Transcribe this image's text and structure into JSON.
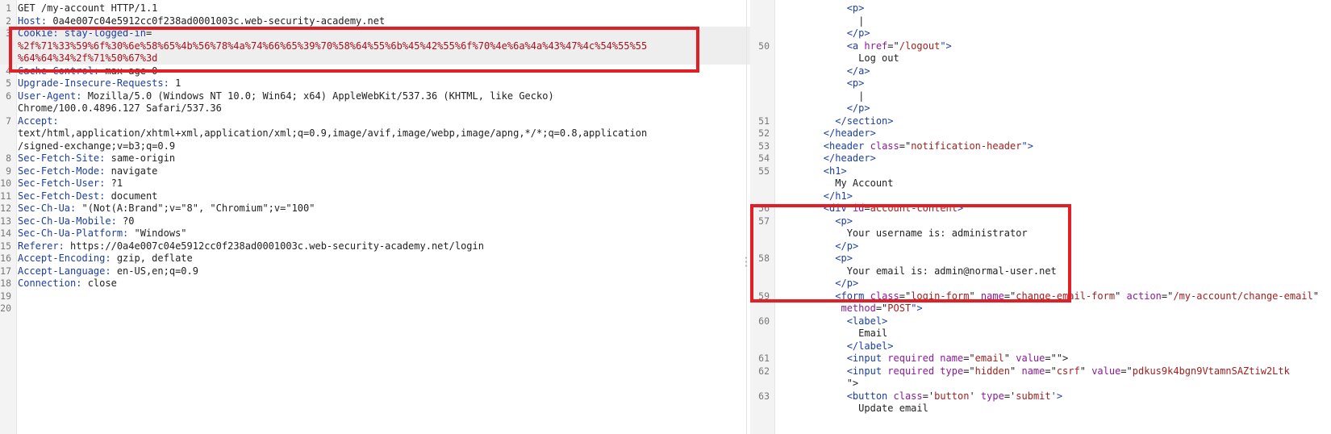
{
  "request": {
    "lines": [
      {
        "n": "1",
        "segs": [
          {
            "t": "GET /my-account HTTP/1.1",
            "c": "txt"
          }
        ]
      },
      {
        "n": "2",
        "segs": [
          {
            "t": "Host: ",
            "c": "hk"
          },
          {
            "t": "0a4e007c04e5912cc0f238ad0001003c.web-security-academy.net",
            "c": "txt"
          }
        ]
      },
      {
        "n": "3",
        "hl": true,
        "segs": [
          {
            "t": "Cookie: ",
            "c": "hk"
          },
          {
            "t": "stay-logged-in",
            "c": "hk"
          },
          {
            "t": "=",
            "c": "txt"
          }
        ]
      },
      {
        "n": "",
        "hl": true,
        "segs": [
          {
            "t": "%2f%71%33%59%6f%30%6e%58%65%4b%56%78%4a%74%66%65%39%70%58%64%55%6b%45%42%55%6f%70%4e%6a%4a%43%47%4c%54%55%55",
            "c": "cookie"
          }
        ]
      },
      {
        "n": "",
        "hl": true,
        "segs": [
          {
            "t": "%64%64%34%2f%71%50%67%3d",
            "c": "cookie"
          }
        ]
      },
      {
        "n": "4",
        "segs": [
          {
            "t": "Cache-Control: ",
            "c": "hk"
          },
          {
            "t": "max-age=0",
            "c": "txt"
          }
        ]
      },
      {
        "n": "5",
        "segs": [
          {
            "t": "Upgrade-Insecure-Requests: ",
            "c": "hk"
          },
          {
            "t": "1",
            "c": "txt"
          }
        ]
      },
      {
        "n": "6",
        "segs": [
          {
            "t": "User-Agent: ",
            "c": "hk"
          },
          {
            "t": "Mozilla/5.0 (Windows NT 10.0; Win64; x64) AppleWebKit/537.36 (KHTML, like Gecko)",
            "c": "txt"
          }
        ]
      },
      {
        "n": "",
        "segs": [
          {
            "t": "Chrome/100.0.4896.127 Safari/537.36",
            "c": "txt"
          }
        ]
      },
      {
        "n": "7",
        "segs": [
          {
            "t": "Accept: ",
            "c": "hk"
          }
        ]
      },
      {
        "n": "",
        "segs": [
          {
            "t": "text/html,application/xhtml+xml,application/xml;q=0.9,image/avif,image/webp,image/apng,*/*;q=0.8,application",
            "c": "txt"
          }
        ]
      },
      {
        "n": "",
        "segs": [
          {
            "t": "/signed-exchange;v=b3;q=0.9",
            "c": "txt"
          }
        ]
      },
      {
        "n": "8",
        "segs": [
          {
            "t": "Sec-Fetch-Site: ",
            "c": "hk"
          },
          {
            "t": "same-origin",
            "c": "txt"
          }
        ]
      },
      {
        "n": "9",
        "segs": [
          {
            "t": "Sec-Fetch-Mode: ",
            "c": "hk"
          },
          {
            "t": "navigate",
            "c": "txt"
          }
        ]
      },
      {
        "n": "10",
        "segs": [
          {
            "t": "Sec-Fetch-User: ",
            "c": "hk"
          },
          {
            "t": "?1",
            "c": "txt"
          }
        ]
      },
      {
        "n": "11",
        "segs": [
          {
            "t": "Sec-Fetch-Dest: ",
            "c": "hk"
          },
          {
            "t": "document",
            "c": "txt"
          }
        ]
      },
      {
        "n": "12",
        "segs": [
          {
            "t": "Sec-Ch-Ua: ",
            "c": "hk"
          },
          {
            "t": "\"(Not(A:Brand\";v=\"8\", \"Chromium\";v=\"100\"",
            "c": "txt"
          }
        ]
      },
      {
        "n": "13",
        "segs": [
          {
            "t": "Sec-Ch-Ua-Mobile: ",
            "c": "hk"
          },
          {
            "t": "?0",
            "c": "txt"
          }
        ]
      },
      {
        "n": "14",
        "segs": [
          {
            "t": "Sec-Ch-Ua-Platform: ",
            "c": "hk"
          },
          {
            "t": "\"Windows\"",
            "c": "txt"
          }
        ]
      },
      {
        "n": "15",
        "segs": [
          {
            "t": "Referer: ",
            "c": "hk"
          },
          {
            "t": "https://0a4e007c04e5912cc0f238ad0001003c.web-security-academy.net/login",
            "c": "txt"
          }
        ]
      },
      {
        "n": "16",
        "segs": [
          {
            "t": "Accept-Encoding: ",
            "c": "hk"
          },
          {
            "t": "gzip, deflate",
            "c": "txt"
          }
        ]
      },
      {
        "n": "17",
        "segs": [
          {
            "t": "Accept-Language: ",
            "c": "hk"
          },
          {
            "t": "en-US,en;q=0.9",
            "c": "txt"
          }
        ]
      },
      {
        "n": "18",
        "segs": [
          {
            "t": "Connection: ",
            "c": "hk"
          },
          {
            "t": "close",
            "c": "txt"
          }
        ]
      },
      {
        "n": "19",
        "segs": []
      },
      {
        "n": "20",
        "segs": []
      }
    ]
  },
  "response": {
    "lines": [
      {
        "n": "",
        "segs": [
          {
            "t": "            <",
            "c": "tag"
          },
          {
            "t": "p",
            "c": "tag"
          },
          {
            "t": ">",
            "c": "tag"
          }
        ]
      },
      {
        "n": "",
        "segs": [
          {
            "t": "              |",
            "c": "txt"
          }
        ]
      },
      {
        "n": "",
        "segs": [
          {
            "t": "            </",
            "c": "tag"
          },
          {
            "t": "p",
            "c": "tag"
          },
          {
            "t": ">",
            "c": "tag"
          }
        ]
      },
      {
        "n": "50",
        "segs": [
          {
            "t": "            <",
            "c": "tag"
          },
          {
            "t": "a",
            "c": "tag"
          },
          {
            "t": " href",
            "c": "attr"
          },
          {
            "t": "=\"",
            "c": "txt"
          },
          {
            "t": "/logout",
            "c": "val"
          },
          {
            "t": "\">",
            "c": "tag"
          }
        ]
      },
      {
        "n": "",
        "segs": [
          {
            "t": "              Log out",
            "c": "txt"
          }
        ]
      },
      {
        "n": "",
        "segs": [
          {
            "t": "            </",
            "c": "tag"
          },
          {
            "t": "a",
            "c": "tag"
          },
          {
            "t": ">",
            "c": "tag"
          }
        ]
      },
      {
        "n": "",
        "segs": [
          {
            "t": "            <",
            "c": "tag"
          },
          {
            "t": "p",
            "c": "tag"
          },
          {
            "t": ">",
            "c": "tag"
          }
        ]
      },
      {
        "n": "",
        "segs": [
          {
            "t": "              |",
            "c": "txt"
          }
        ]
      },
      {
        "n": "",
        "segs": [
          {
            "t": "            </",
            "c": "tag"
          },
          {
            "t": "p",
            "c": "tag"
          },
          {
            "t": ">",
            "c": "tag"
          }
        ]
      },
      {
        "n": "51",
        "segs": [
          {
            "t": "          </",
            "c": "tag"
          },
          {
            "t": "section",
            "c": "tag"
          },
          {
            "t": ">",
            "c": "tag"
          }
        ]
      },
      {
        "n": "52",
        "segs": [
          {
            "t": "        </",
            "c": "tag"
          },
          {
            "t": "header",
            "c": "tag"
          },
          {
            "t": ">",
            "c": "tag"
          }
        ]
      },
      {
        "n": "53",
        "segs": [
          {
            "t": "        <",
            "c": "tag"
          },
          {
            "t": "header",
            "c": "tag"
          },
          {
            "t": " class",
            "c": "attr"
          },
          {
            "t": "=\"",
            "c": "txt"
          },
          {
            "t": "notification-header",
            "c": "val"
          },
          {
            "t": "\">",
            "c": "tag"
          }
        ]
      },
      {
        "n": "54",
        "segs": [
          {
            "t": "        </",
            "c": "tag"
          },
          {
            "t": "header",
            "c": "tag"
          },
          {
            "t": ">",
            "c": "tag"
          }
        ]
      },
      {
        "n": "55",
        "segs": [
          {
            "t": "        <",
            "c": "tag"
          },
          {
            "t": "h1",
            "c": "tag"
          },
          {
            "t": ">",
            "c": "tag"
          }
        ]
      },
      {
        "n": "",
        "segs": [
          {
            "t": "          My Account",
            "c": "txt"
          }
        ]
      },
      {
        "n": "",
        "segs": [
          {
            "t": "        </",
            "c": "tag"
          },
          {
            "t": "h1",
            "c": "tag"
          },
          {
            "t": ">",
            "c": "tag"
          }
        ]
      },
      {
        "n": "56",
        "segs": [
          {
            "t": "        <",
            "c": "tag"
          },
          {
            "t": "div",
            "c": "tag"
          },
          {
            "t": " id",
            "c": "attr"
          },
          {
            "t": "=",
            "c": "txt"
          },
          {
            "t": "account-content",
            "c": "val"
          },
          {
            "t": ">",
            "c": "tag"
          }
        ]
      },
      {
        "n": "57",
        "segs": [
          {
            "t": "          <",
            "c": "tag"
          },
          {
            "t": "p",
            "c": "tag"
          },
          {
            "t": ">",
            "c": "tag"
          }
        ]
      },
      {
        "n": "",
        "segs": [
          {
            "t": "            Your username is: administrator",
            "c": "txt"
          }
        ]
      },
      {
        "n": "",
        "segs": [
          {
            "t": "          </",
            "c": "tag"
          },
          {
            "t": "p",
            "c": "tag"
          },
          {
            "t": ">",
            "c": "tag"
          }
        ]
      },
      {
        "n": "58",
        "segs": [
          {
            "t": "          <",
            "c": "tag"
          },
          {
            "t": "p",
            "c": "tag"
          },
          {
            "t": ">",
            "c": "tag"
          }
        ]
      },
      {
        "n": "",
        "segs": [
          {
            "t": "            Your email is: admin@normal-user.net",
            "c": "txt"
          }
        ]
      },
      {
        "n": "",
        "segs": [
          {
            "t": "          </",
            "c": "tag"
          },
          {
            "t": "p",
            "c": "tag"
          },
          {
            "t": ">",
            "c": "tag"
          }
        ]
      },
      {
        "n": "59",
        "segs": [
          {
            "t": "          <",
            "c": "tag"
          },
          {
            "t": "form",
            "c": "tag"
          },
          {
            "t": " class",
            "c": "attr"
          },
          {
            "t": "=\"",
            "c": "txt"
          },
          {
            "t": "login-form",
            "c": "val"
          },
          {
            "t": "\"",
            "c": "txt"
          },
          {
            "t": " name",
            "c": "attr"
          },
          {
            "t": "=\"",
            "c": "txt"
          },
          {
            "t": "change-email-form",
            "c": "val"
          },
          {
            "t": "\"",
            "c": "txt"
          },
          {
            "t": " action",
            "c": "attr"
          },
          {
            "t": "=\"",
            "c": "txt"
          },
          {
            "t": "/my-account/change-email",
            "c": "val"
          },
          {
            "t": "\"",
            "c": "txt"
          }
        ]
      },
      {
        "n": "",
        "segs": [
          {
            "t": "           method",
            "c": "attr"
          },
          {
            "t": "=\"",
            "c": "txt"
          },
          {
            "t": "POST",
            "c": "val"
          },
          {
            "t": "\">",
            "c": "tag"
          }
        ]
      },
      {
        "n": "60",
        "segs": [
          {
            "t": "            <",
            "c": "tag"
          },
          {
            "t": "label",
            "c": "tag"
          },
          {
            "t": ">",
            "c": "tag"
          }
        ]
      },
      {
        "n": "",
        "segs": [
          {
            "t": "              Email",
            "c": "txt"
          }
        ]
      },
      {
        "n": "",
        "segs": [
          {
            "t": "            </",
            "c": "tag"
          },
          {
            "t": "label",
            "c": "tag"
          },
          {
            "t": ">",
            "c": "tag"
          }
        ]
      },
      {
        "n": "61",
        "segs": [
          {
            "t": "            <",
            "c": "tag"
          },
          {
            "t": "input",
            "c": "tag"
          },
          {
            "t": " required name",
            "c": "attr"
          },
          {
            "t": "=\"",
            "c": "txt"
          },
          {
            "t": "email",
            "c": "val"
          },
          {
            "t": "\"",
            "c": "txt"
          },
          {
            "t": " value",
            "c": "attr"
          },
          {
            "t": "=\"\">",
            "c": "txt"
          }
        ]
      },
      {
        "n": "62",
        "segs": [
          {
            "t": "            <",
            "c": "tag"
          },
          {
            "t": "input",
            "c": "tag"
          },
          {
            "t": " required type",
            "c": "attr"
          },
          {
            "t": "=\"",
            "c": "txt"
          },
          {
            "t": "hidden",
            "c": "val"
          },
          {
            "t": "\"",
            "c": "txt"
          },
          {
            "t": " name",
            "c": "attr"
          },
          {
            "t": "=\"",
            "c": "txt"
          },
          {
            "t": "csrf",
            "c": "val"
          },
          {
            "t": "\"",
            "c": "txt"
          },
          {
            "t": " value",
            "c": "attr"
          },
          {
            "t": "=\"",
            "c": "txt"
          },
          {
            "t": "pdkus9k4bgn9VtamnSAZtiw2Ltk",
            "c": "val"
          }
        ]
      },
      {
        "n": "",
        "segs": [
          {
            "t": "            \">",
            "c": "txt"
          }
        ]
      },
      {
        "n": "63",
        "segs": [
          {
            "t": "            <",
            "c": "tag"
          },
          {
            "t": "button",
            "c": "tag"
          },
          {
            "t": " class",
            "c": "attr"
          },
          {
            "t": "='",
            "c": "txt"
          },
          {
            "t": "button",
            "c": "val"
          },
          {
            "t": "'",
            "c": "txt"
          },
          {
            "t": " type",
            "c": "attr"
          },
          {
            "t": "='",
            "c": "txt"
          },
          {
            "t": "submit",
            "c": "val"
          },
          {
            "t": "'>",
            "c": "tag"
          }
        ]
      },
      {
        "n": "",
        "segs": [
          {
            "t": "              Update email",
            "c": "txt"
          }
        ]
      }
    ]
  },
  "colors": {
    "highlight_box": "#e31f26",
    "header_key": "#1b3ea0",
    "cookie_value": "#a8111b",
    "attr_name": "#8a1a9a",
    "attr_value": "#a11f1f"
  },
  "icons": {
    "splitter_grip": "drag-grip-icon"
  }
}
